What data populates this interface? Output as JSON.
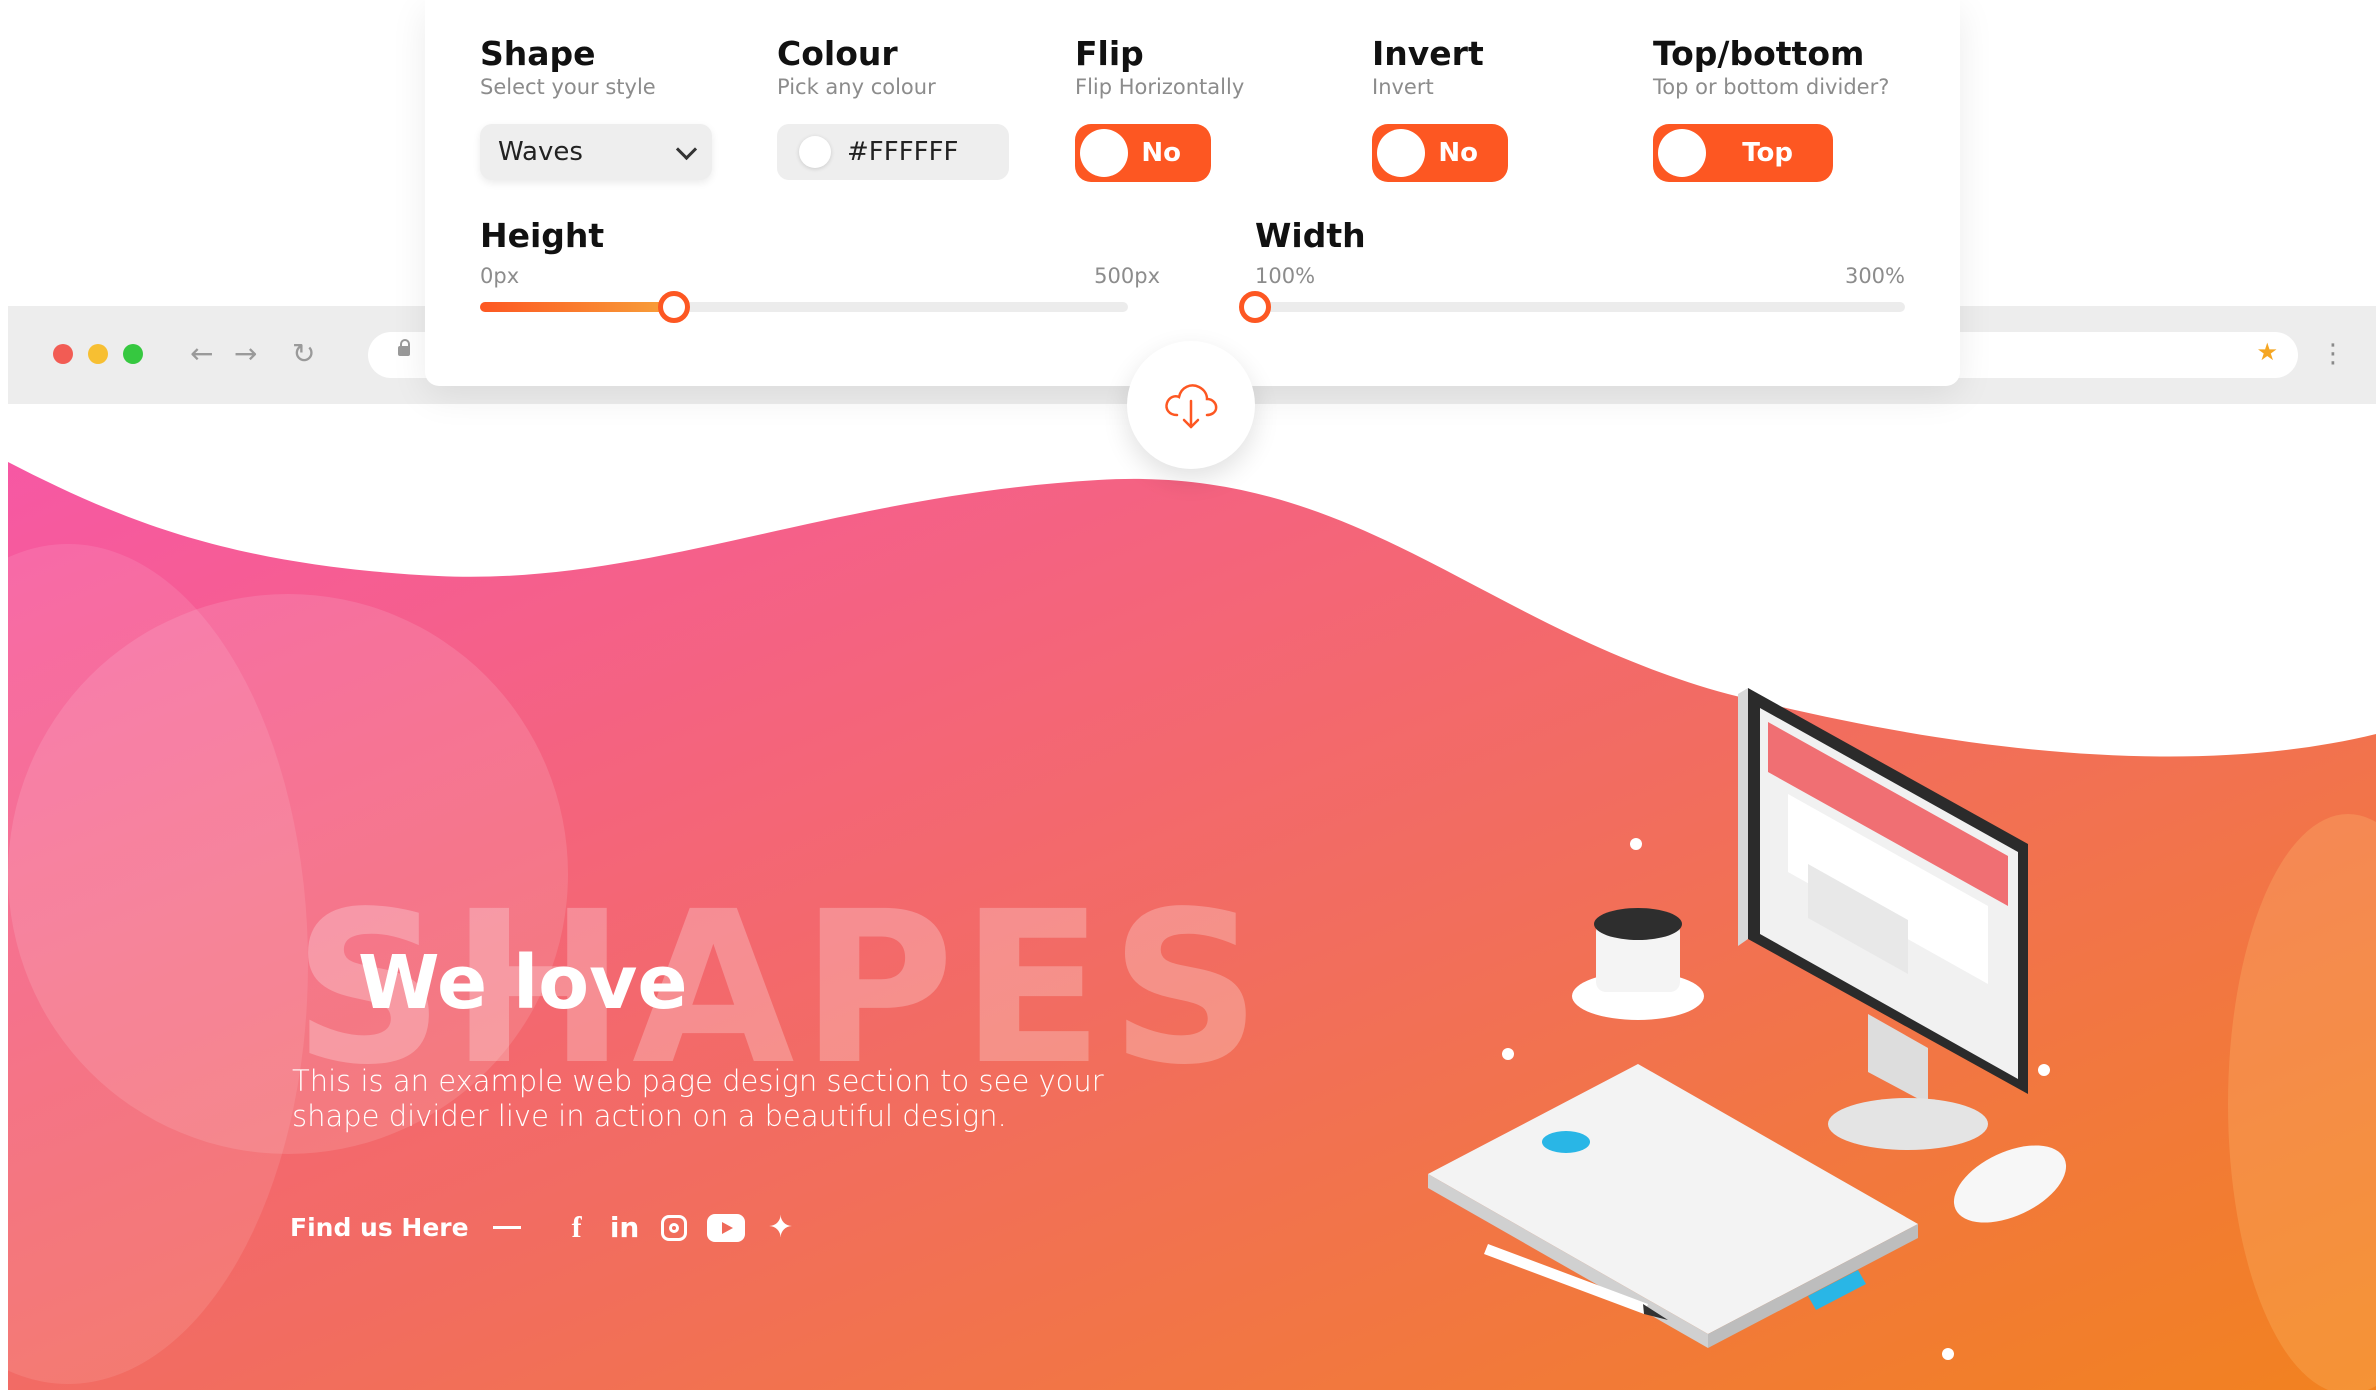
{
  "controls": {
    "shape": {
      "title": "Shape",
      "subtitle": "Select your style",
      "selected": "Waves"
    },
    "colour": {
      "title": "Colour",
      "subtitle": "Pick any colour",
      "value": "#FFFFFF",
      "swatch": "#FFFFFF"
    },
    "flip": {
      "title": "Flip",
      "subtitle": "Flip Horizontally",
      "value": "No"
    },
    "invert": {
      "title": "Invert",
      "subtitle": "Invert",
      "value": "No"
    },
    "position": {
      "title": "Top/bottom",
      "subtitle": "Top or bottom divider?",
      "value": "Top"
    },
    "height": {
      "title": "Height",
      "min_label": "0px",
      "max_label": "500px",
      "fraction": 0.3
    },
    "width": {
      "title": "Width",
      "min_label": "100%",
      "max_label": "300%",
      "fraction": 0.0
    },
    "download_icon": "cloud-download-icon"
  },
  "browser": {
    "nav_icons": [
      "back-arrow-icon",
      "forward-arrow-icon",
      "reload-icon"
    ],
    "address_icons": [
      "lock-icon",
      "star-icon"
    ]
  },
  "hero": {
    "background_word": "SHAPES",
    "heading": "We love",
    "description": "This is an example web page design section to see your shape divider live in action on a beautiful design.",
    "find_us": "Find us Here",
    "social_icons": [
      "facebook-icon",
      "linkedin-icon",
      "instagram-icon",
      "youtube-icon",
      "twitter-icon"
    ]
  },
  "colors": {
    "accent": "#FD5722",
    "gradient_start": "#F757A8",
    "gradient_end": "#F2821F"
  }
}
